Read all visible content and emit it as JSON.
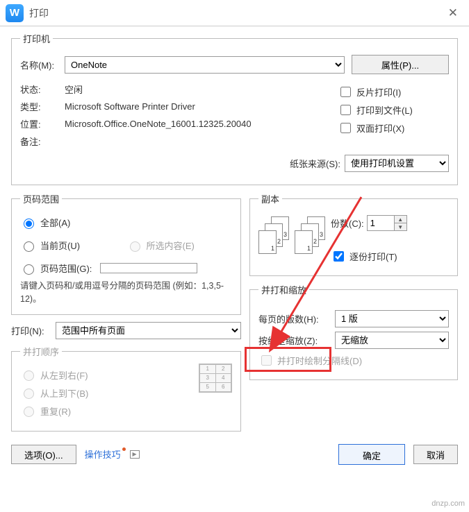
{
  "window": {
    "title": "打印",
    "icon_letter": "W"
  },
  "printer_group": {
    "legend": "打印机",
    "name_label": "名称(M):",
    "name_value": "OneNote",
    "properties_btn": "属性(P)...",
    "status_label": "状态:",
    "status_value": "空闲",
    "type_label": "类型:",
    "type_value": "Microsoft Software Printer Driver",
    "location_label": "位置:",
    "location_value": "Microsoft.Office.OneNote_16001.12325.20040",
    "remark_label": "备注:",
    "mirror_label": "反片打印(I)",
    "tofile_label": "打印到文件(L)",
    "duplex_label": "双面打印(X)",
    "paper_source_label": "纸张来源(S):",
    "paper_source_value": "使用打印机设置"
  },
  "range_group": {
    "legend": "页码范围",
    "all_label": "全部(A)",
    "current_label": "当前页(U)",
    "selection_label": "所选内容(E)",
    "pages_label": "页码范围(G):",
    "hint": "请键入页码和/或用逗号分隔的页码范围 (例如：1,3,5-12)。",
    "print_label": "打印(N):",
    "print_value": "范围中所有页面"
  },
  "copies_group": {
    "legend": "副本",
    "copies_label": "份数(C):",
    "copies_value": "1",
    "collate_label": "逐份打印(T)"
  },
  "nup_group": {
    "legend_disabled": "并打顺序",
    "ltr_label": "从左到右(F)",
    "ttb_label": "从上到下(B)",
    "repeat_label": "重复(R)"
  },
  "zoom_group": {
    "legend": "并打和缩放",
    "pps_label": "每页的版数(H):",
    "pps_value": "1 版",
    "scale_label": "按纸型缩放(Z):",
    "scale_value": "无缩放",
    "sep_label": "并打时绘制分隔线(D)"
  },
  "footer": {
    "options_btn": "选项(O)...",
    "tips_label": "操作技巧",
    "ok_btn": "确定",
    "cancel_btn": "取消"
  },
  "watermark": "dnzp.com"
}
